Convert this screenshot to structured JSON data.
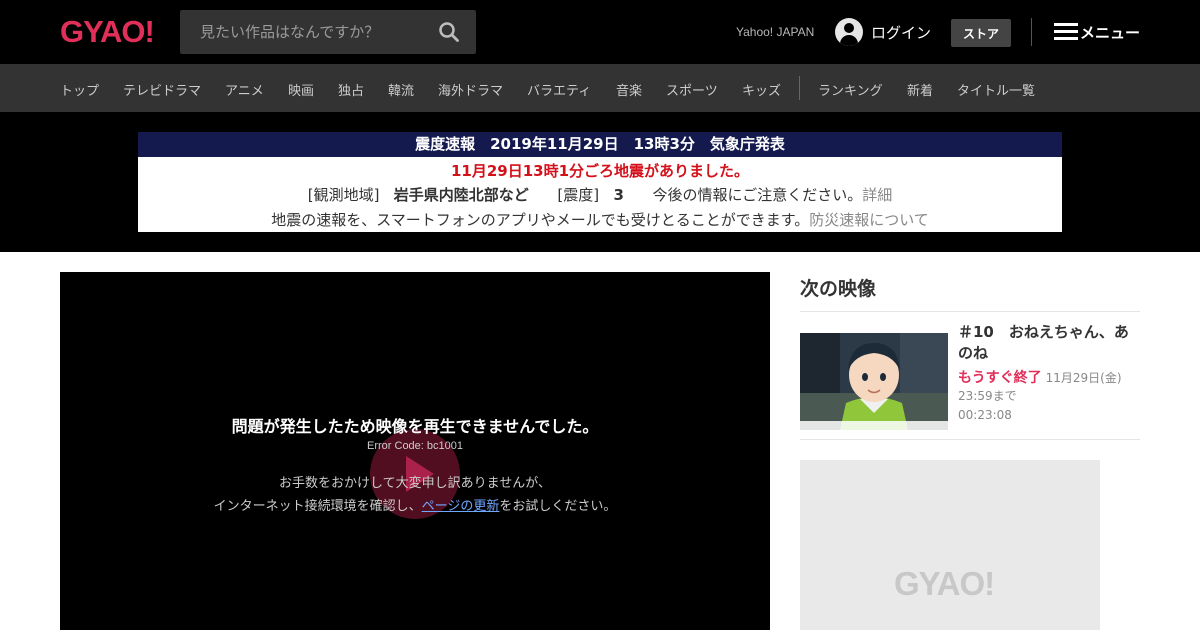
{
  "header": {
    "logo": "GYAO!",
    "search_placeholder": "見たい作品はなんですか？",
    "yahoo_link": "Yahoo! JAPAN",
    "login_label": "ログイン",
    "store_label": "ストア",
    "menu_label": "メニュー"
  },
  "nav": {
    "items": [
      "トップ",
      "テレビドラマ",
      "アニメ",
      "映画",
      "独占",
      "韓流",
      "海外ドラマ",
      "バラエティ",
      "音楽",
      "スポーツ",
      "キッズ"
    ],
    "extra_items": [
      "ランキング",
      "新着",
      "タイトル一覧"
    ]
  },
  "alert": {
    "title": "震度速報　2019年11月29日　13時3分　気象庁発表",
    "line1": "11月29日13時1分ごろ地震がありました。",
    "region_label": "[観測地域]",
    "region": "岩手県内陸北部など",
    "intensity_label": "[震度]",
    "intensity": "3",
    "notice": "今後の情報にご注意ください。",
    "detail_link": "詳細",
    "line3": "地震の速報を、スマートフォンのアプリやメールでも受けとることができます。",
    "disaster_link": "防災速報について"
  },
  "player": {
    "error_title": "問題が発生したため映像を再生できませんでした。",
    "error_code": "Error Code: bc1001",
    "message_line1": "お手数をおかけして大変申し訳ありませんが、",
    "message_line2_pre": "インターネット接続環境を確認し、",
    "message_link": "ページの更新",
    "message_line2_post": "をお試しください。"
  },
  "sidebar": {
    "heading": "次の映像",
    "next": {
      "title": "＃10　おねえちゃん、あのね",
      "ending_tag": "もうすぐ終了",
      "ending_date": "11月29日(金) 23:59まで",
      "duration": "00:23:08"
    },
    "ad_logo": "GYAO!"
  },
  "colors": {
    "brand": "#e0305a",
    "alert_title_bg": "#141a4e",
    "alert_red": "#d4111b"
  }
}
